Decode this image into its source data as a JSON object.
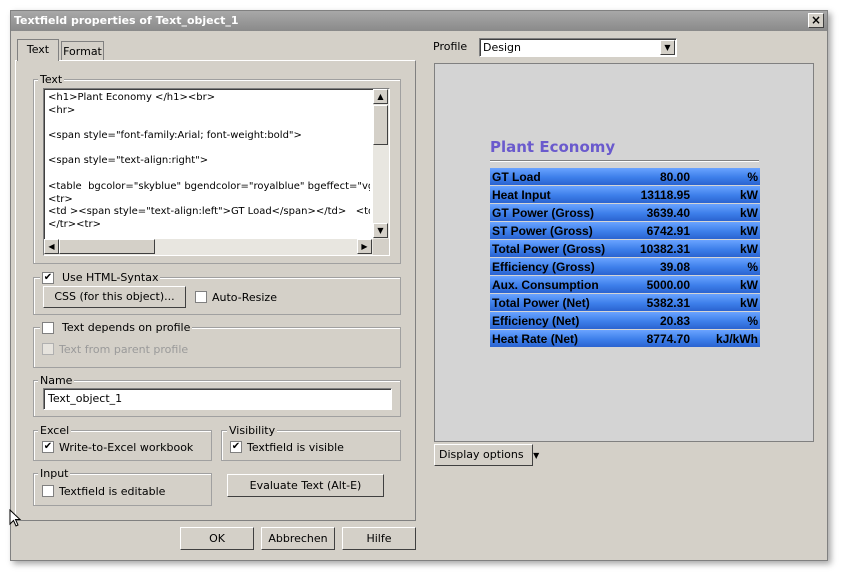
{
  "window": {
    "title": "Textfield properties of Text_object_1",
    "close_glyph": "×"
  },
  "tabs": [
    {
      "label": "Text",
      "active": true
    },
    {
      "label": "Format",
      "active": false
    }
  ],
  "text_group": {
    "label": "Text",
    "lines": [
      "<h1>Plant Economy </h1><br>",
      "<hr>",
      "",
      "<span style=\"font-family:Arial; font-weight:bold\">",
      "",
      "<span style=\"text-align:right\">",
      "",
      "<table  bgcolor=\"skyblue\" bgendcolor=\"royalblue\" bgeffect=\"vgrad",
      "<tr>",
      "<td ><span style=\"text-align:left\">GT Load</span></td>   <td>",
      "</tr><tr>"
    ]
  },
  "html_group": {
    "use_html_label": "Use HTML-Syntax",
    "use_html_checked": true,
    "css_button": "CSS (for this object)...",
    "auto_resize_label": "Auto-Resize",
    "auto_resize_checked": false
  },
  "profile_group": {
    "depends_label": "Text depends on profile",
    "depends_checked": false,
    "parent_label": "Text from parent profile",
    "parent_checked": false
  },
  "name_group": {
    "label": "Name",
    "value": "Text_object_1"
  },
  "excel_group": {
    "label": "Excel",
    "checkbox_label": "Write-to-Excel workbook",
    "checked": true
  },
  "visibility_group": {
    "label": "Visibility",
    "checkbox_label": "Textfield is visible",
    "checked": true
  },
  "input_group": {
    "label": "Input",
    "checkbox_label": "Textfield is editable",
    "checked": false
  },
  "evaluate_button": "Evaluate Text (Alt-E)",
  "footer": {
    "ok": "OK",
    "cancel": "Abbrechen",
    "help": "Hilfe"
  },
  "profile": {
    "label": "Profile",
    "selected": "Design"
  },
  "display_options_button": "Display options",
  "preview": {
    "heading": "Plant Economy",
    "rows": [
      {
        "label": "GT Load",
        "value": "80.00",
        "unit": "%"
      },
      {
        "label": "Heat Input",
        "value": "13118.95",
        "unit": "kW"
      },
      {
        "label": "GT Power (Gross)",
        "value": "3639.40",
        "unit": "kW"
      },
      {
        "label": "ST Power (Gross)",
        "value": "6742.91",
        "unit": "kW"
      },
      {
        "label": "Total Power (Gross)",
        "value": "10382.31",
        "unit": "kW"
      },
      {
        "label": "Efficiency (Gross)",
        "value": "39.08",
        "unit": "%"
      },
      {
        "label": "Aux. Consumption",
        "value": "5000.00",
        "unit": "kW"
      },
      {
        "label": "Total Power (Net)",
        "value": "5382.31",
        "unit": "kW"
      },
      {
        "label": "Efficiency (Net)",
        "value": "20.83",
        "unit": "%"
      },
      {
        "label": "Heat Rate (Net)",
        "value": "8774.70",
        "unit": "kJ/kWh"
      }
    ],
    "colors": {
      "heading": "#6a5acd",
      "gradient_start": "#87ceeb",
      "gradient_end": "#4169e1"
    }
  },
  "icons": {
    "check": "✔",
    "arrow_up": "▲",
    "arrow_down": "▼",
    "arrow_left": "◀",
    "arrow_right": "▶",
    "dropdown": "▼"
  }
}
